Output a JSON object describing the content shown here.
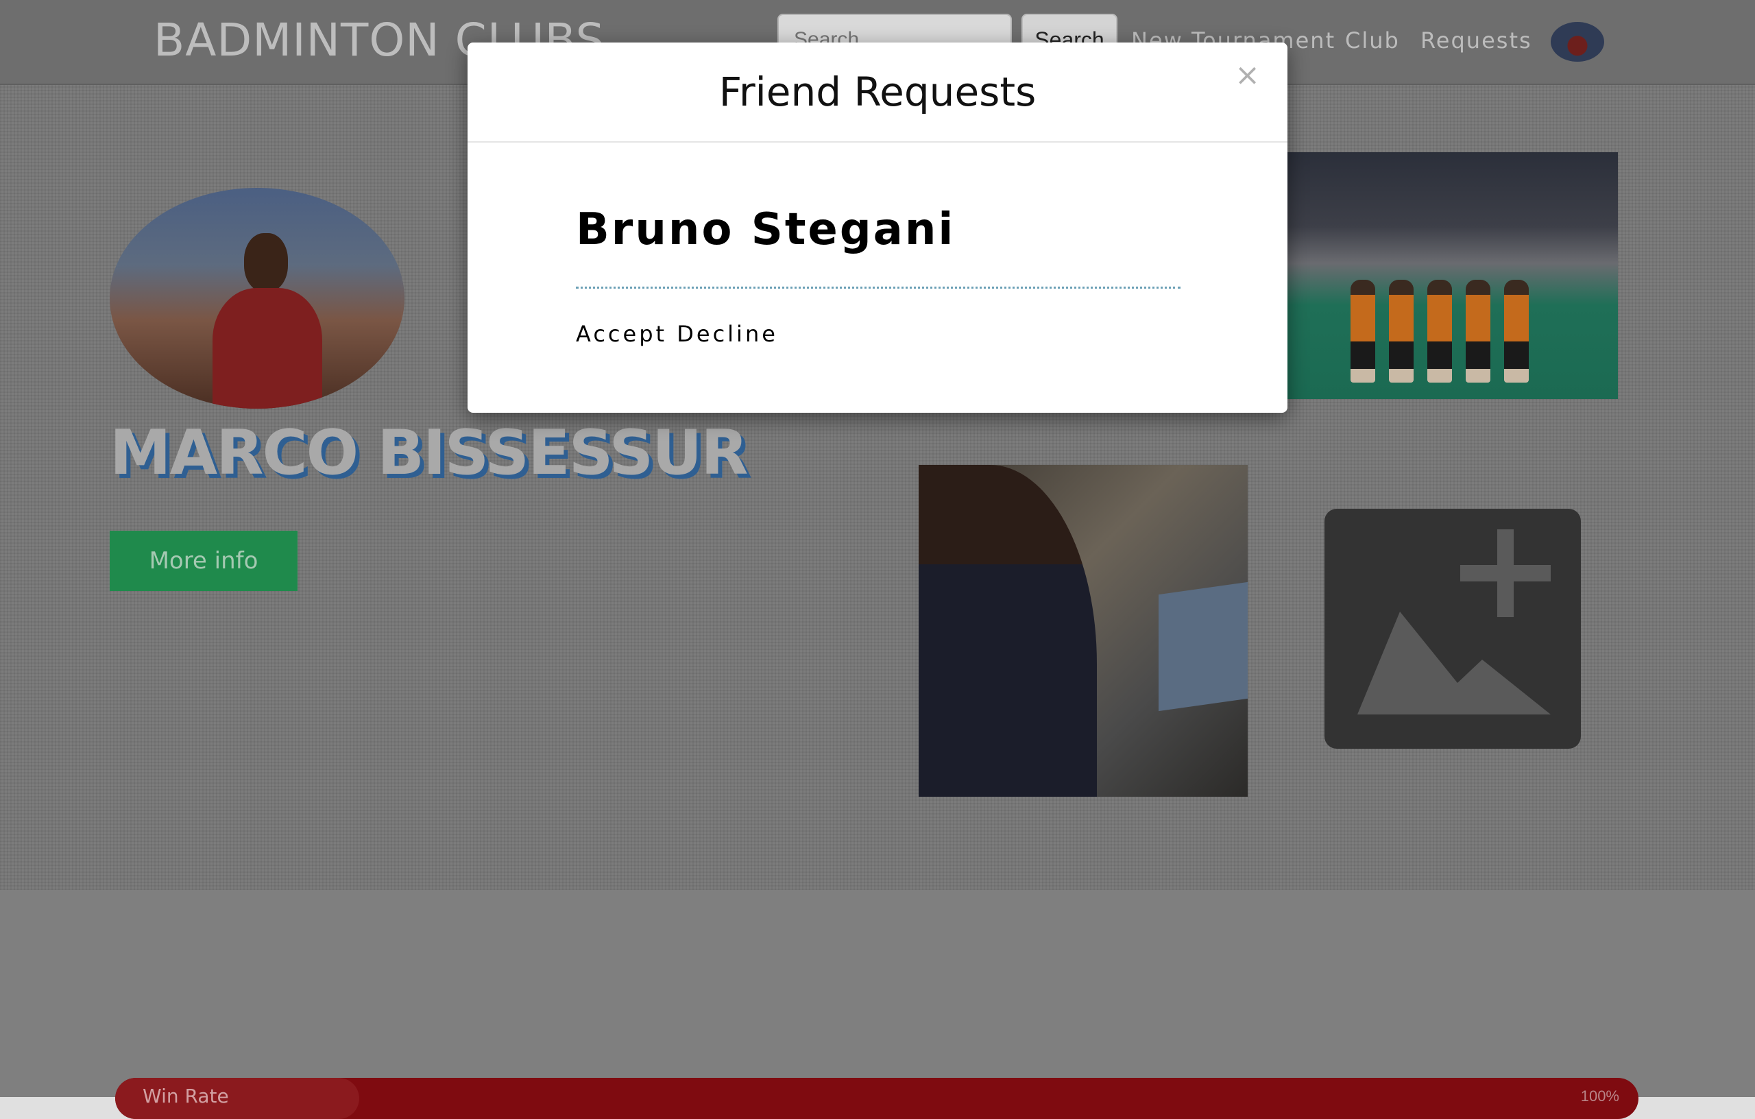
{
  "navbar": {
    "brand": "BADMINTON CLUBS",
    "search_placeholder": "Search",
    "search_button": "Search",
    "links": [
      "New Tournament",
      "Club",
      "Requests"
    ]
  },
  "profile": {
    "name": "MARCO BISSESSUR",
    "more_info_button": "More info"
  },
  "stats": {
    "win_rate_label": "Win Rate",
    "win_rate_value": "100%",
    "win_rate_fill_fraction": 0.16
  },
  "modal": {
    "title": "Friend Requests",
    "close_symbol": "×",
    "requests": [
      {
        "name": "Bruno Stegani",
        "accept_label": "Accept",
        "decline_label": "Decline"
      }
    ]
  },
  "colors": {
    "more_info_button": "#1f8a4c",
    "name_shadow": "#2f5f92",
    "win_rate_bar": "#7f0b10"
  }
}
